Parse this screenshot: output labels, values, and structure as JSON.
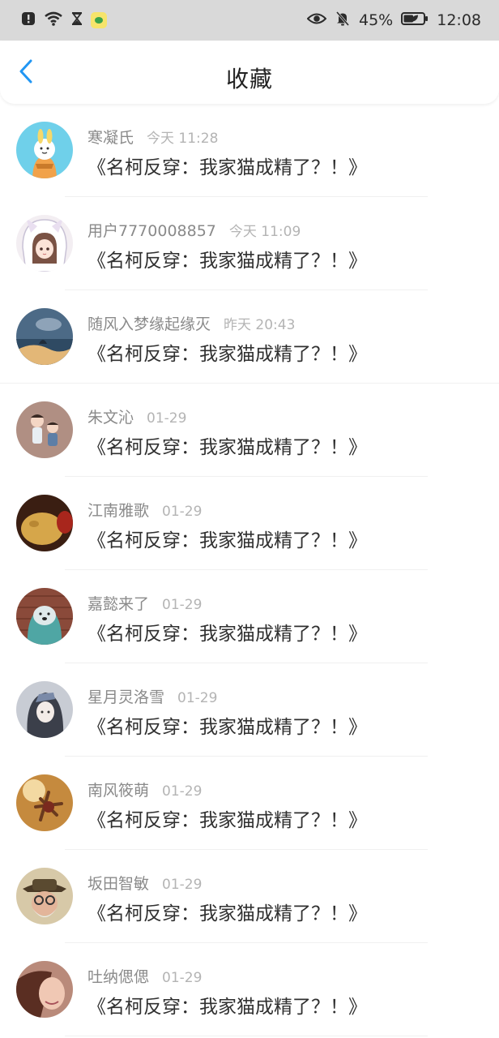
{
  "status_bar": {
    "battery": "45%",
    "time": "12:08"
  },
  "header": {
    "title": "收藏"
  },
  "items": [
    {
      "name": "寒凝氏",
      "time": "今天 11:28",
      "book": "《名柯反穿：我家猫成精了？！》"
    },
    {
      "name": "用户7770008857",
      "time": "今天 11:09",
      "book": "《名柯反穿：我家猫成精了？！》"
    },
    {
      "name": "随风入梦缘起缘灭",
      "time": "昨天 20:43",
      "book": "《名柯反穿：我家猫成精了？！》"
    },
    {
      "name": "朱文沁",
      "time": "01-29",
      "book": "《名柯反穿：我家猫成精了？！》"
    },
    {
      "name": "江南雅歌",
      "time": "01-29",
      "book": "《名柯反穿：我家猫成精了？！》"
    },
    {
      "name": "嘉懿来了",
      "time": "01-29",
      "book": "《名柯反穿：我家猫成精了？！》"
    },
    {
      "name": "星月灵洛雪",
      "time": "01-29",
      "book": "《名柯反穿：我家猫成精了？！》"
    },
    {
      "name": "南风筱萌",
      "time": "01-29",
      "book": "《名柯反穿：我家猫成精了？！》"
    },
    {
      "name": "坂田智敏",
      "time": "01-29",
      "book": "《名柯反穿：我家猫成精了？！》"
    },
    {
      "name": "吐纳偲偲",
      "time": "01-29",
      "book": "《名柯反穿：我家猫成精了？！》"
    }
  ],
  "colors": {
    "accent": "#2196f3",
    "status_bar_bg": "#d9d9d9",
    "name_text": "#8a8a8a",
    "time_text": "#b4b4b4",
    "book_text": "#303030"
  },
  "icons": {
    "back": "chevron-left-icon",
    "avatar": "avatar"
  }
}
